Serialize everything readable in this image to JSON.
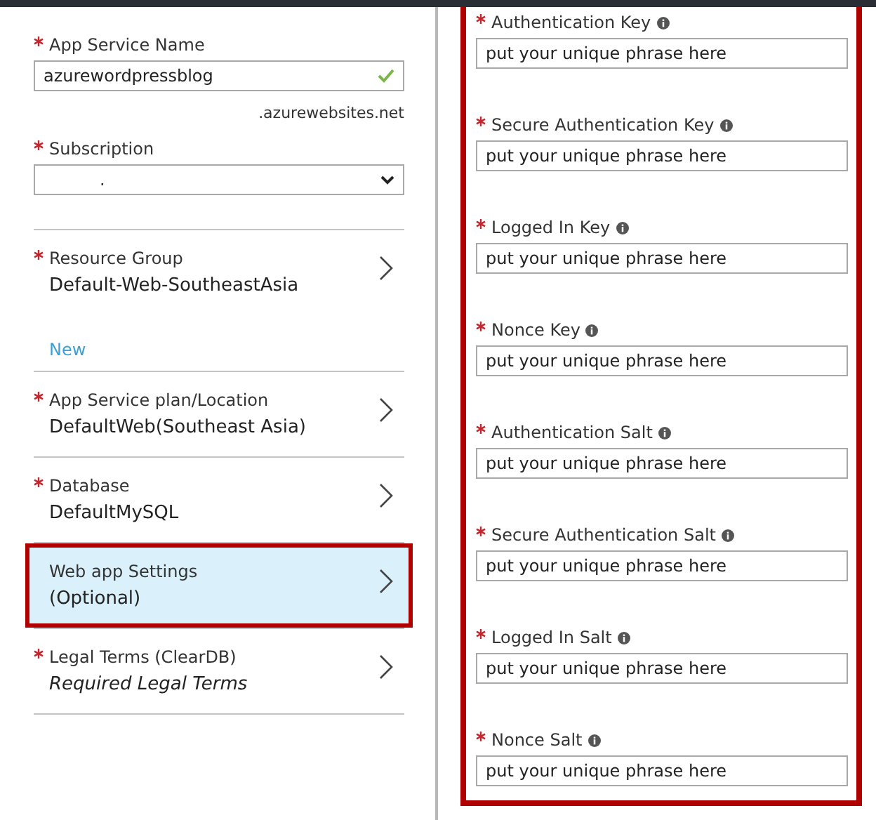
{
  "app_service": {
    "label": "App Service Name",
    "required": true,
    "value": "azurewordpressblog",
    "valid": true,
    "suffix": ".azurewebsites.net"
  },
  "subscription": {
    "label": "Subscription",
    "required": true,
    "value": "."
  },
  "nav_items": [
    {
      "label": "Resource Group",
      "required": true,
      "value": "Default-Web-SoutheastAsia",
      "italic": false,
      "selected": false,
      "outlined": false,
      "link": "New"
    },
    {
      "label": "App Service plan/Location",
      "required": true,
      "value": "DefaultWeb(Southeast Asia)",
      "italic": false,
      "selected": false,
      "outlined": false
    },
    {
      "label": "Database",
      "required": true,
      "value": "DefaultMySQL",
      "italic": false,
      "selected": false,
      "outlined": false
    },
    {
      "label": "Web app Settings",
      "required": false,
      "value": "(Optional)",
      "italic": false,
      "selected": true,
      "outlined": true
    },
    {
      "label": "Legal Terms (ClearDB)",
      "required": true,
      "value": "Required Legal Terms",
      "italic": true,
      "selected": false,
      "outlined": false
    }
  ],
  "settings_panel": {
    "outlined": true,
    "fields": [
      {
        "label": "Authentication Key",
        "required": true,
        "value": "put your unique phrase here"
      },
      {
        "label": "Secure Authentication Key",
        "required": true,
        "value": "put your unique phrase here"
      },
      {
        "label": "Logged In Key",
        "required": true,
        "value": "put your unique phrase here"
      },
      {
        "label": "Nonce Key",
        "required": true,
        "value": "put your unique phrase here"
      },
      {
        "label": "Authentication Salt",
        "required": true,
        "value": "put your unique phrase here"
      },
      {
        "label": "Secure Authentication Salt",
        "required": true,
        "value": "put your unique phrase here"
      },
      {
        "label": "Logged In Salt",
        "required": true,
        "value": "put your unique phrase here"
      },
      {
        "label": "Nonce Salt",
        "required": true,
        "value": "put your unique phrase here"
      }
    ]
  }
}
